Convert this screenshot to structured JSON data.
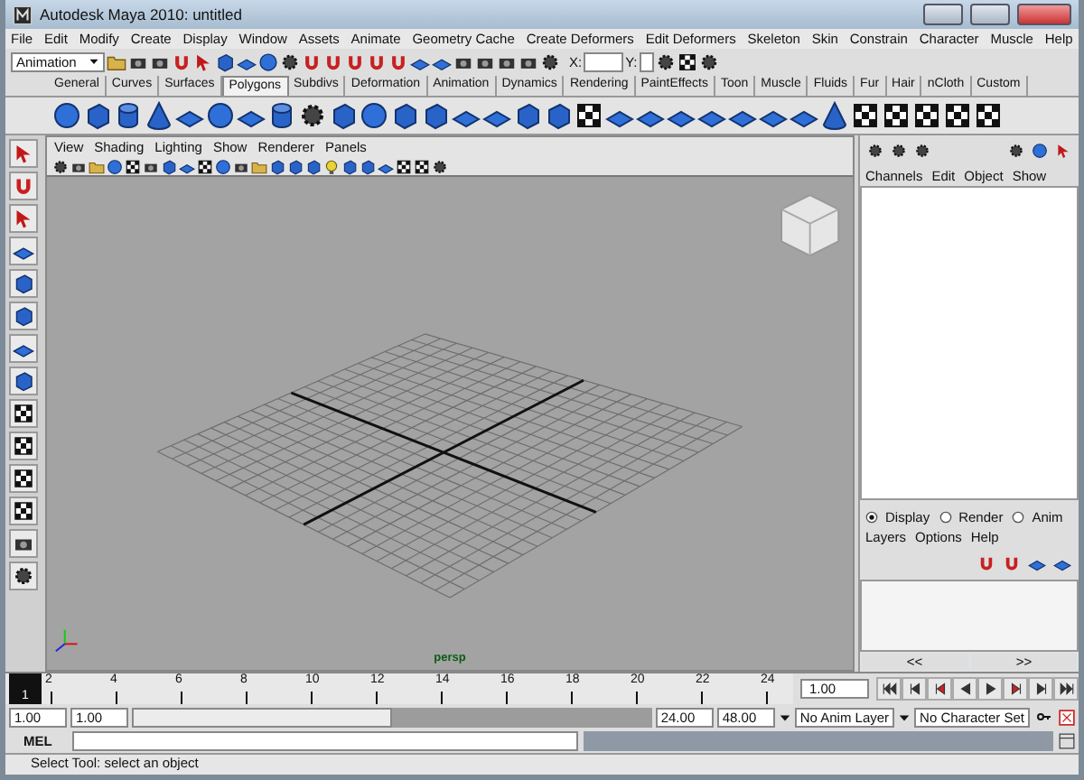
{
  "window": {
    "title": "Autodesk Maya 2010: untitled"
  },
  "menu_bar": [
    "File",
    "Edit",
    "Modify",
    "Create",
    "Display",
    "Window",
    "Assets",
    "Animate",
    "Geometry Cache",
    "Create Deformers",
    "Edit Deformers",
    "Skeleton",
    "Skin",
    "Constrain",
    "Character",
    "Muscle",
    "Help"
  ],
  "status_line": {
    "mode": "Animation",
    "x_label": "X:",
    "y_label": "Y:"
  },
  "shelf": {
    "tabs": [
      {
        "label": "General",
        "selected": false
      },
      {
        "label": "Curves",
        "selected": false
      },
      {
        "label": "Surfaces",
        "selected": false
      },
      {
        "label": "Polygons",
        "selected": true
      },
      {
        "label": "Subdivs",
        "selected": false
      },
      {
        "label": "Deformation",
        "selected": false
      },
      {
        "label": "Animation",
        "selected": false
      },
      {
        "label": "Dynamics",
        "selected": false
      },
      {
        "label": "Rendering",
        "selected": false
      },
      {
        "label": "PaintEffects",
        "selected": false
      },
      {
        "label": "Toon",
        "selected": false
      },
      {
        "label": "Muscle",
        "selected": false
      },
      {
        "label": "Fluids",
        "selected": false
      },
      {
        "label": "Fur",
        "selected": false
      },
      {
        "label": "Hair",
        "selected": false
      },
      {
        "label": "nCloth",
        "selected": false
      },
      {
        "label": "Custom",
        "selected": false
      }
    ]
  },
  "viewport": {
    "menu": [
      "View",
      "Shading",
      "Lighting",
      "Show",
      "Renderer",
      "Panels"
    ],
    "camera_label": "persp"
  },
  "channel_box": {
    "menu": [
      "Channels",
      "Edit",
      "Object",
      "Show"
    ]
  },
  "layer_editor": {
    "modes": [
      {
        "label": "Display",
        "selected": true
      },
      {
        "label": "Render",
        "selected": false
      },
      {
        "label": "Anim",
        "selected": false
      }
    ],
    "menu": [
      "Layers",
      "Options",
      "Help"
    ],
    "scroll_left": "<<",
    "scroll_right": ">>"
  },
  "time_slider": {
    "current_frame": "1",
    "ticks": [
      "2",
      "4",
      "6",
      "8",
      "10",
      "12",
      "14",
      "16",
      "18",
      "20",
      "22",
      "24"
    ],
    "current_time": "1.00"
  },
  "range_slider": {
    "start_time": "1.00",
    "playback_start": "1.00",
    "playback_end": "24.00",
    "end_time": "48.00",
    "anim_layer": "No Anim Layer",
    "character_set": "No Character Set"
  },
  "command_line": {
    "label": "MEL"
  },
  "help_line": "Select Tool: select an object"
}
